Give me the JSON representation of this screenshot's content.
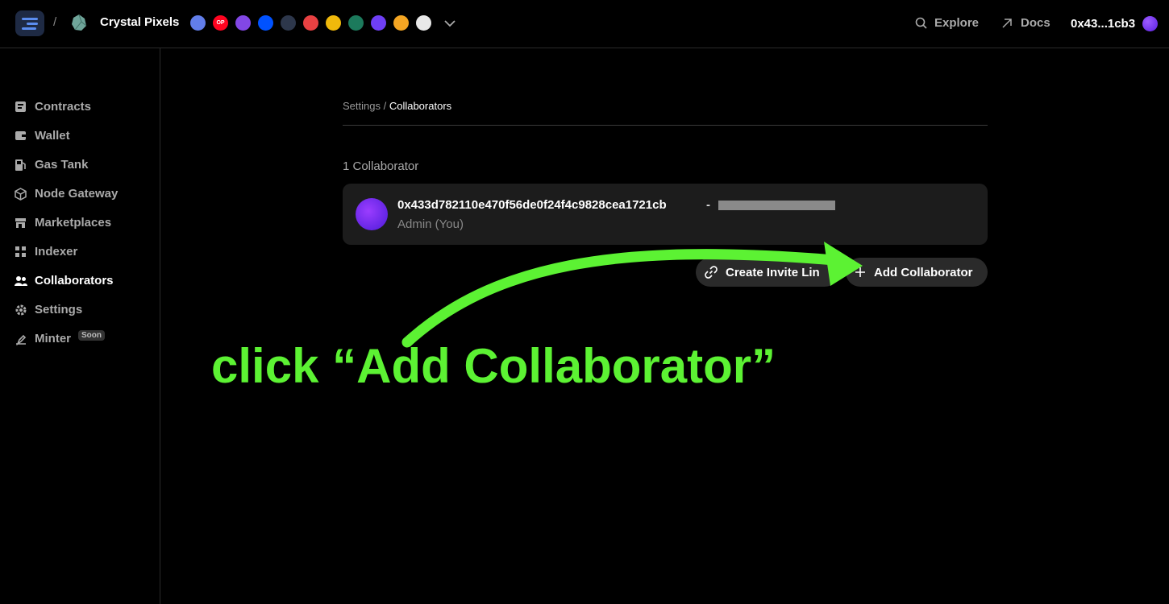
{
  "header": {
    "project_name": "Crystal Pixels",
    "separator": "/",
    "chains": [
      {
        "name": "ethereum-icon",
        "color": "#627eea",
        "label": ""
      },
      {
        "name": "optimism-icon",
        "color": "#ff0420",
        "label": "OP"
      },
      {
        "name": "polygon-icon",
        "color": "#8247e5",
        "label": ""
      },
      {
        "name": "base-icon",
        "color": "#0052ff",
        "label": ""
      },
      {
        "name": "arbitrum-icon",
        "color": "#2d374b",
        "label": ""
      },
      {
        "name": "avalanche-icon",
        "color": "#e84142",
        "label": ""
      },
      {
        "name": "bnb-icon",
        "color": "#f0b90b",
        "label": ""
      },
      {
        "name": "moonbeam-icon",
        "color": "#1c7a5c",
        "label": ""
      },
      {
        "name": "astar-icon",
        "color": "#6f3ff5",
        "label": ""
      },
      {
        "name": "near-icon",
        "color": "#f5a623",
        "label": ""
      },
      {
        "name": "zksync-icon",
        "color": "#e8e8e8",
        "label": ""
      }
    ],
    "explore_label": "Explore",
    "docs_label": "Docs",
    "wallet_address": "0x43...1cb3"
  },
  "sidebar": {
    "items": [
      {
        "label": "Contracts",
        "icon": "contracts-icon",
        "active": false
      },
      {
        "label": "Wallet",
        "icon": "wallet-icon",
        "active": false
      },
      {
        "label": "Gas Tank",
        "icon": "gas-tank-icon",
        "active": false
      },
      {
        "label": "Node Gateway",
        "icon": "cube-icon",
        "active": false
      },
      {
        "label": "Marketplaces",
        "icon": "store-icon",
        "active": false
      },
      {
        "label": "Indexer",
        "icon": "grid-icon",
        "active": false
      },
      {
        "label": "Collaborators",
        "icon": "users-icon",
        "active": true
      },
      {
        "label": "Settings",
        "icon": "gear-icon",
        "active": false
      },
      {
        "label": "Minter",
        "icon": "minter-icon",
        "active": false,
        "badge": "Soon"
      }
    ]
  },
  "main": {
    "breadcrumb": {
      "parent": "Settings",
      "separator": " / ",
      "current": "Collaborators"
    },
    "count_label": "1 Collaborator",
    "collaborator": {
      "address": "0x433d782110e470f56de0f24f4c9828cea1721cb",
      "separator": "-",
      "role": "Admin (You)"
    },
    "invite_button_label": "Create Invite Lin",
    "add_button_label": "Add Collaborator"
  },
  "annotation": {
    "text": "click “Add Collaborator”",
    "color": "#5cf233"
  }
}
